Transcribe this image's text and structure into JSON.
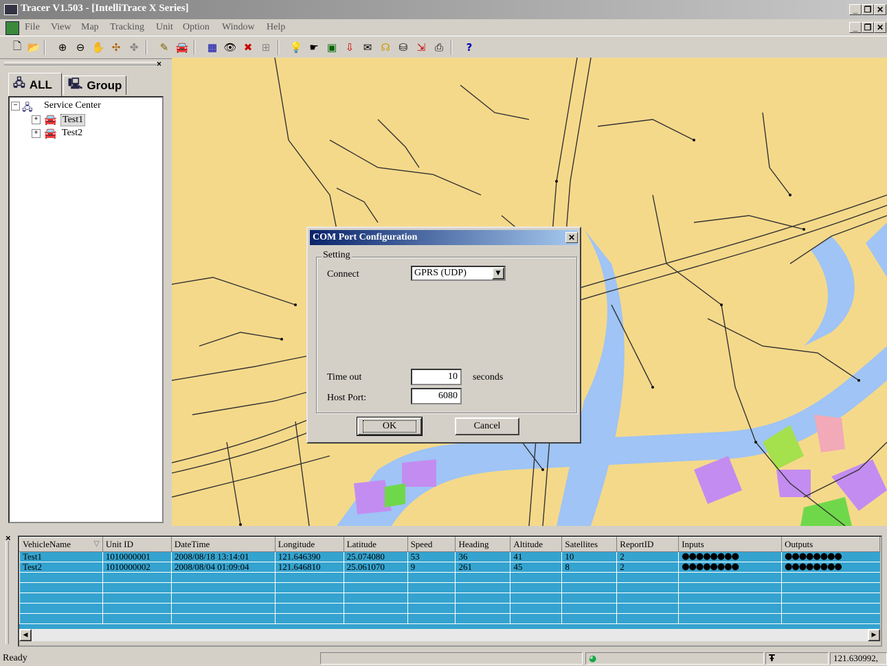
{
  "window": {
    "title": "Tracer V1.503 - [IntelliTrace X Series]"
  },
  "menu": [
    "File",
    "View",
    "Map",
    "Tracking",
    "Unit",
    "Option",
    "Window",
    "Help"
  ],
  "tabs": {
    "all": "ALL",
    "group": "Group"
  },
  "tree": {
    "root": "Service Center",
    "children": [
      "Test1",
      "Test2"
    ]
  },
  "dialog": {
    "title": "COM Port Configuration",
    "group_label": "Setting",
    "connect_label": "Connect",
    "connect_value": "GPRS (UDP)",
    "timeout_label": "Time out",
    "timeout_value": "10",
    "timeout_unit": "seconds",
    "hostport_label": "Host Port:",
    "hostport_value": "6080",
    "ok_label": "OK",
    "cancel_label": "Cancel"
  },
  "grid": {
    "columns": [
      "VehicleName",
      "Unit ID",
      "DateTime",
      "Longitude",
      "Latitude",
      "Speed",
      "Heading",
      "Altitude",
      "Satellites",
      "ReportID",
      "Inputs",
      "Outputs"
    ],
    "rows": [
      [
        "Test1",
        "1010000001",
        "2008/08/18 13:14:01",
        "121.646390",
        "25.074080",
        "53",
        "36",
        "41",
        "10",
        "2"
      ],
      [
        "Test2",
        "1010000002",
        "2008/08/04 01:09:04",
        "121.646810",
        "25.061070",
        "9",
        "261",
        "45",
        "8",
        "2"
      ]
    ],
    "io_indicator": "●●●●●●●●"
  },
  "status": {
    "left": "Ready",
    "coord": "121.630992,"
  }
}
